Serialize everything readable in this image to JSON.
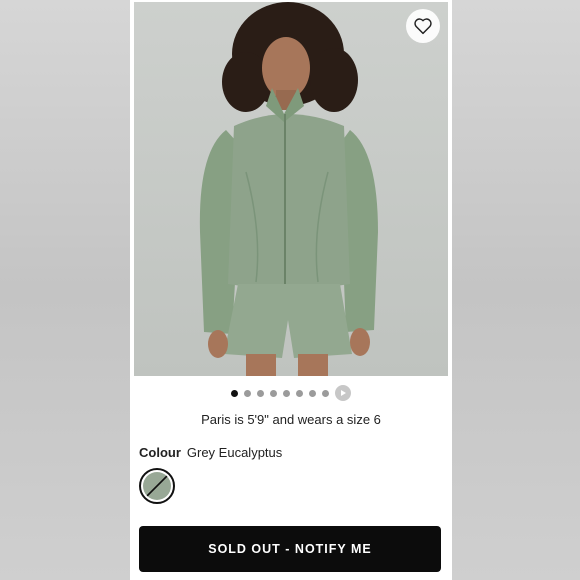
{
  "product": {
    "image_alt": "Model wearing green zip-up jacket and shorts",
    "favorite_icon": "heart-outline-icon",
    "carousel": {
      "total_images": 8,
      "active_index": 0,
      "has_video": true
    },
    "fit_caption": "Paris is 5'9\" and wears a size 6",
    "colour": {
      "label": "Colour",
      "value": "Grey Eucalyptus",
      "swatch_hex": "#98a896",
      "sold_out": true
    },
    "cta_label": "SOLD OUT - NOTIFY ME"
  },
  "colors": {
    "cta_bg": "#0c0c0c",
    "garment": "#8ea38b",
    "backdrop": "#c5c8c5"
  }
}
